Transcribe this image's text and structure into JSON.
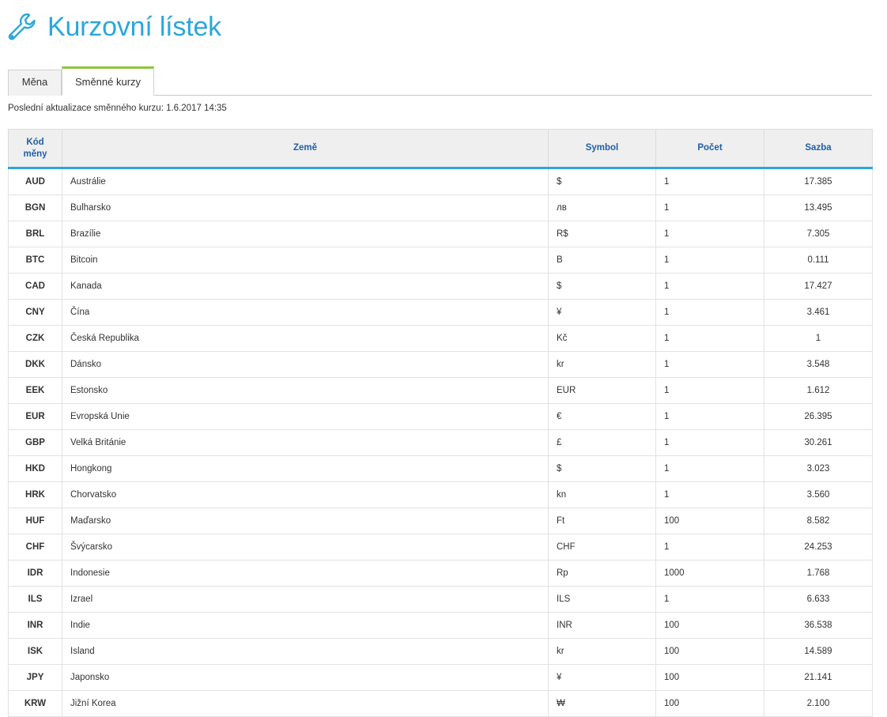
{
  "page": {
    "title": "Kurzovní lístek",
    "icon": "wrench-icon"
  },
  "tabs": [
    {
      "label": "Měna",
      "active": false
    },
    {
      "label": "Směnné kurzy",
      "active": true
    }
  ],
  "last_update": "Poslední aktualizace směnného kurzu: 1.6.2017 14:35",
  "colors": {
    "title": "#2aa7dc",
    "header_text": "#1f5fa8",
    "header_underline": "#2aa7dc",
    "active_tab": "#8cc63f"
  },
  "table": {
    "headers": {
      "code_line1": "Kód",
      "code_line2": "měny",
      "country": "Země",
      "symbol": "Symbol",
      "count": "Počet",
      "rate": "Sazba"
    },
    "rows": [
      {
        "code": "AUD",
        "country": "Austrálie",
        "symbol": "$",
        "count": "1",
        "rate": "17.385"
      },
      {
        "code": "BGN",
        "country": "Bulharsko",
        "symbol": "лв",
        "count": "1",
        "rate": "13.495"
      },
      {
        "code": "BRL",
        "country": "Brazílie",
        "symbol": "R$",
        "count": "1",
        "rate": "7.305"
      },
      {
        "code": "BTC",
        "country": "Bitcoin",
        "symbol": "B",
        "count": "1",
        "rate": "0.111"
      },
      {
        "code": "CAD",
        "country": "Kanada",
        "symbol": "$",
        "count": "1",
        "rate": "17.427"
      },
      {
        "code": "CNY",
        "country": "Čína",
        "symbol": "¥",
        "count": "1",
        "rate": "3.461"
      },
      {
        "code": "CZK",
        "country": "Česká Republika",
        "symbol": "Kč",
        "count": "1",
        "rate": "1"
      },
      {
        "code": "DKK",
        "country": "Dánsko",
        "symbol": "kr",
        "count": "1",
        "rate": "3.548"
      },
      {
        "code": "EEK",
        "country": "Estonsko",
        "symbol": "EUR",
        "count": "1",
        "rate": "1.612"
      },
      {
        "code": "EUR",
        "country": "Evropská Unie",
        "symbol": "€",
        "count": "1",
        "rate": "26.395"
      },
      {
        "code": "GBP",
        "country": "Velká Británie",
        "symbol": "£",
        "count": "1",
        "rate": "30.261"
      },
      {
        "code": "HKD",
        "country": "Hongkong",
        "symbol": "$",
        "count": "1",
        "rate": "3.023"
      },
      {
        "code": "HRK",
        "country": "Chorvatsko",
        "symbol": "kn",
        "count": "1",
        "rate": "3.560"
      },
      {
        "code": "HUF",
        "country": "Maďarsko",
        "symbol": "Ft",
        "count": "100",
        "rate": "8.582"
      },
      {
        "code": "CHF",
        "country": "Švýcarsko",
        "symbol": "CHF",
        "count": "1",
        "rate": "24.253"
      },
      {
        "code": "IDR",
        "country": "Indonesie",
        "symbol": "Rp",
        "count": "1000",
        "rate": "1.768"
      },
      {
        "code": "ILS",
        "country": "Izrael",
        "symbol": "ILS",
        "count": "1",
        "rate": "6.633"
      },
      {
        "code": "INR",
        "country": "Indie",
        "symbol": "INR",
        "count": "100",
        "rate": "36.538"
      },
      {
        "code": "ISK",
        "country": "Island",
        "symbol": "kr",
        "count": "100",
        "rate": "14.589"
      },
      {
        "code": "JPY",
        "country": "Japonsko",
        "symbol": "¥",
        "count": "100",
        "rate": "21.141"
      },
      {
        "code": "KRW",
        "country": "Jižní Korea",
        "symbol": "₩",
        "count": "100",
        "rate": "2.100"
      }
    ]
  }
}
